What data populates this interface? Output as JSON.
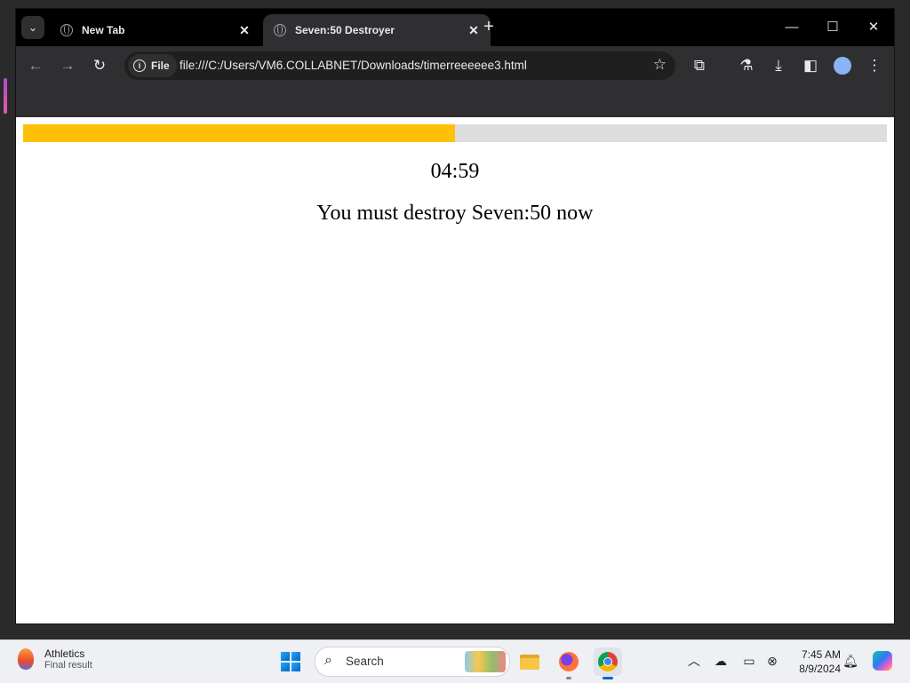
{
  "browser": {
    "tabs": [
      {
        "label": "New Tab",
        "active": false
      },
      {
        "label": "Seven:50 Destroyer",
        "active": true
      }
    ],
    "site_chip": "File",
    "url": "file:///C:/Users/VM6.COLLABNET/Downloads/timerreeeeee3.html"
  },
  "page": {
    "progress_fraction": 0.5,
    "progress_color": "#ffc107",
    "track_color": "#dddddd",
    "timer": "04:59",
    "message": "You must destroy Seven:50 now"
  },
  "taskbar": {
    "widget_title": "Athletics",
    "widget_subtitle": "Final result",
    "search_label": "Search",
    "time": "7:45 AM",
    "date": "8/9/2024"
  }
}
